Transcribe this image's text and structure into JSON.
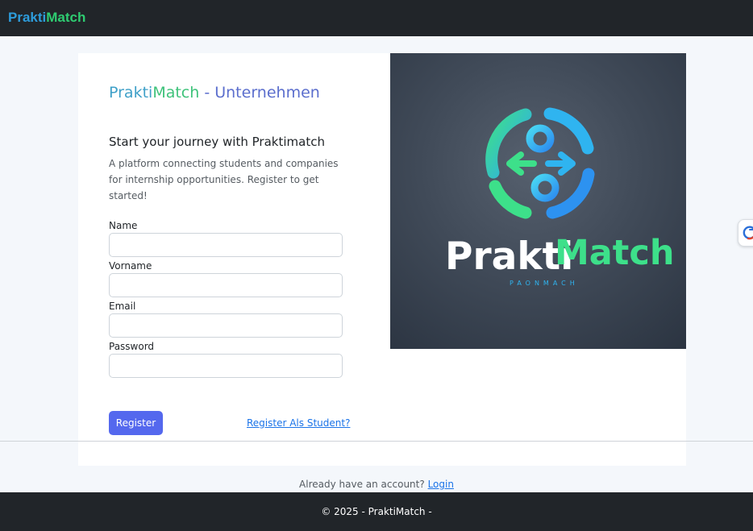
{
  "navbar": {
    "brand_part1": "Prakti",
    "brand_part2": "Match"
  },
  "form_card": {
    "title_part1": "Prakti",
    "title_part2": "Match",
    "title_part3": " - Unternehmen",
    "heading": "Start your journey with Praktimatch",
    "intro": "A platform connecting students and companies for internship opportunities. Register to get started!",
    "fields": [
      {
        "label": "Name",
        "value": "",
        "placeholder": ""
      },
      {
        "label": "Vorname",
        "value": "",
        "placeholder": ""
      },
      {
        "label": "Email",
        "value": "",
        "placeholder": ""
      },
      {
        "label": "Password",
        "value": "",
        "placeholder": ""
      }
    ],
    "register_label": "Register",
    "student_link": "Register Als Student?"
  },
  "logo_image": {
    "word_part1": "Prakti",
    "word_part2": "Match",
    "tagline": "PAONMACH"
  },
  "account": {
    "prompt": "Already have an account?",
    "login_label": "Login"
  },
  "footer": {
    "text": "© 2025 - PraktiMatch -"
  },
  "colors": {
    "navbar_bg": "#212529",
    "brand_blue": "#2d9cdb",
    "brand_green": "#2ecc71",
    "title_accent": "#5b6ecd",
    "button_primary": "#5468ee",
    "link": "#1a73e8"
  },
  "icons": {
    "side_widget": "refresh-icon"
  }
}
